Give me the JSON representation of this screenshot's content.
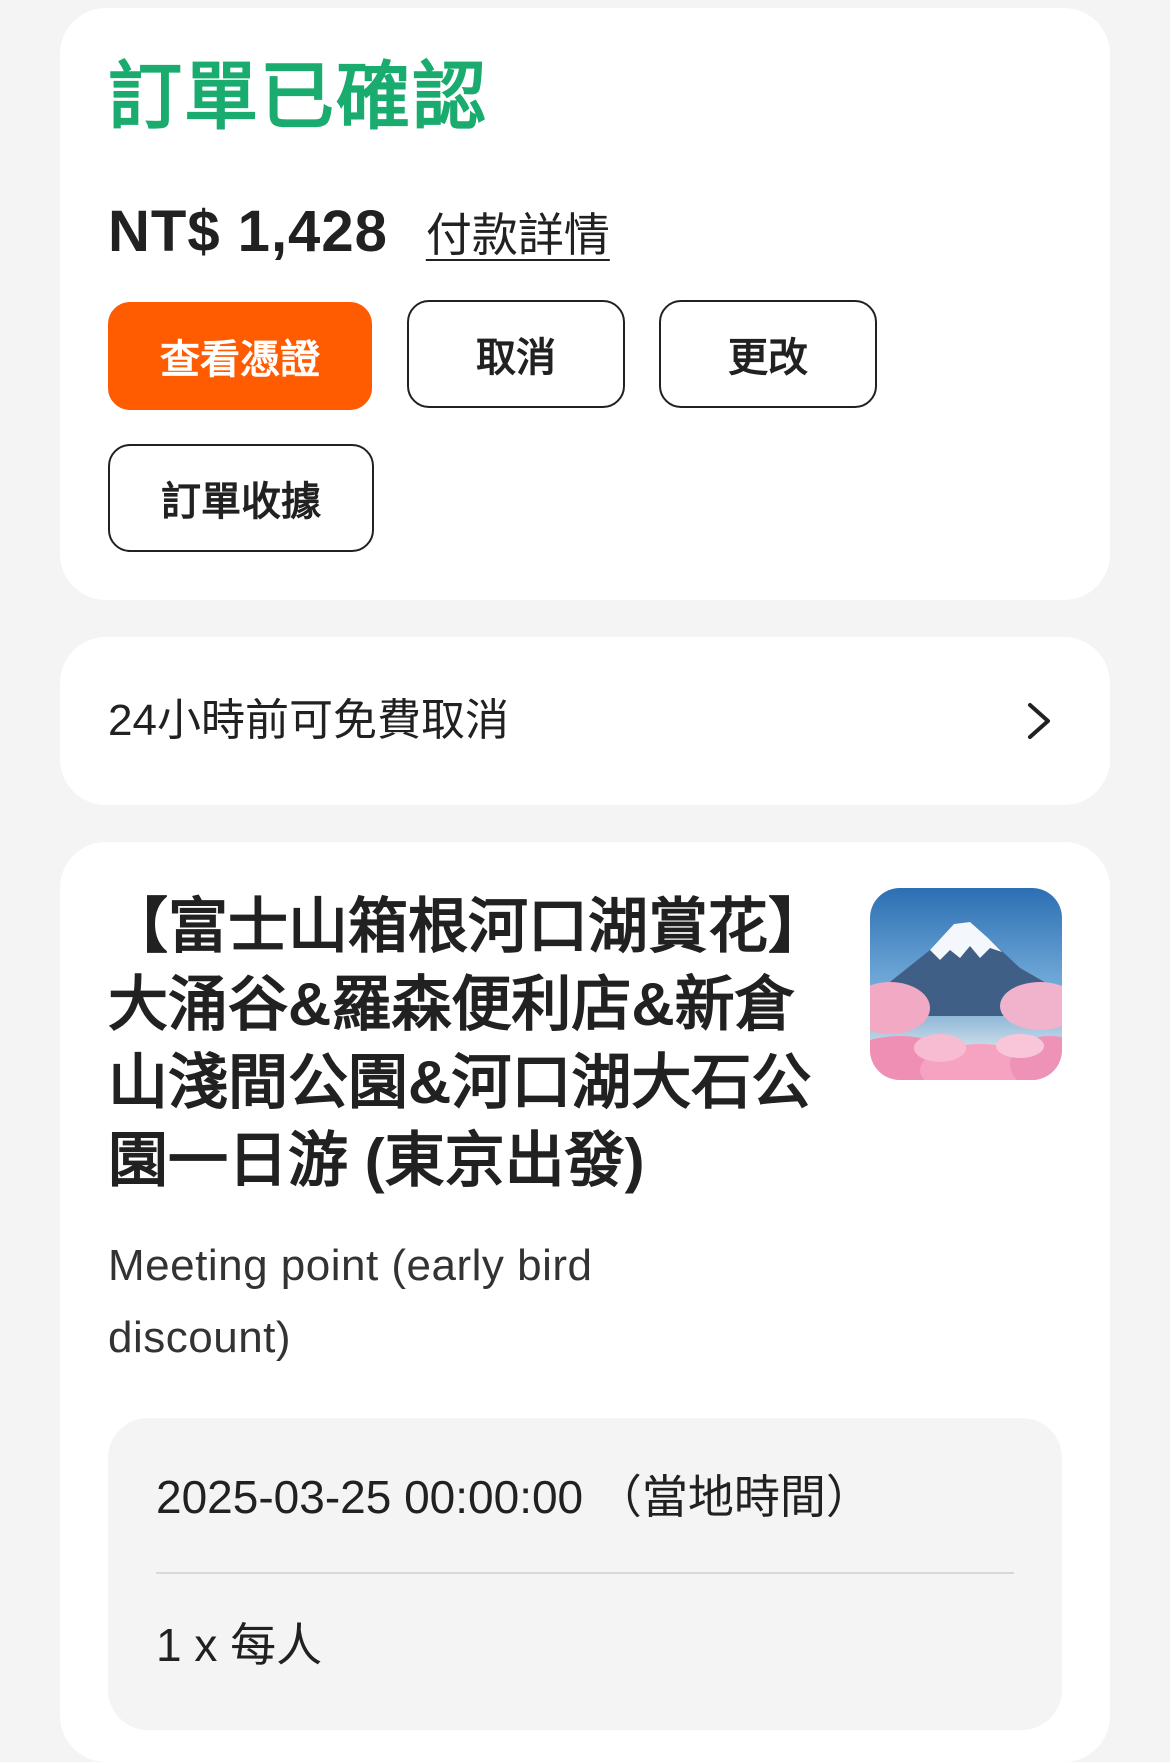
{
  "order": {
    "status": "訂單已確認",
    "price": "NT$ 1,428",
    "payment_details_link": "付款詳情",
    "status_color": "#1aab6f"
  },
  "actions": {
    "view_voucher": "查看憑證",
    "cancel": "取消",
    "change": "更改",
    "receipt": "訂單收據",
    "primary_color": "#ff5b00"
  },
  "cancellation": {
    "policy": "24小時前可免費取消",
    "icon": "chevron-right-icon"
  },
  "product": {
    "title": "【富士山箱根河口湖賞花】大涌谷&羅森便利店&新倉山淺間公園&河口湖大石公園一日游 (東京出發)",
    "package": "Meeting point (early bird discount)",
    "thumbnail": "mount-fuji-cherry-blossom-image",
    "date": "2025-03-25 00:00:00 （當地時間）",
    "quantity": "1 x 每人"
  }
}
